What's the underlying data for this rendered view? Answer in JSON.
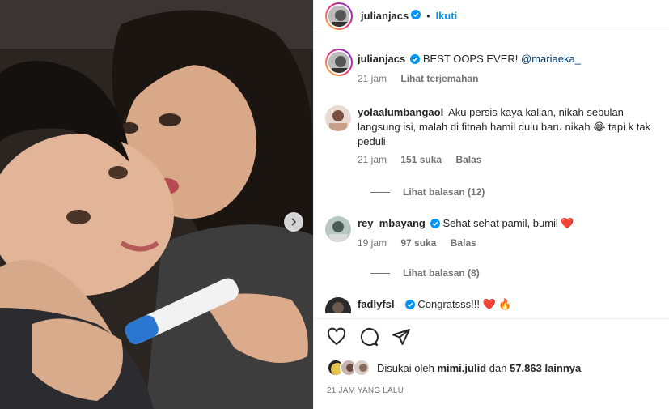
{
  "header": {
    "username": "julianjacs",
    "dot": "•",
    "follow_label": "Ikuti"
  },
  "caption": {
    "username": "julianjacs",
    "text": "BEST OOPS EVER! ",
    "mention": "@mariaeka_",
    "time": "21 jam",
    "translate_label": "Lihat terjemahan"
  },
  "comments": [
    {
      "username": "yolaalumbangaol",
      "text": "Aku persis kaya kalian, nikah sebulan langsung isi, malah di fitnah hamil dulu baru nikah 😂 tapi k tak peduli",
      "time": "21 jam",
      "likes": "151 suka",
      "reply_label": "Balas",
      "view_replies": "Lihat balasan (12)"
    },
    {
      "username": "rey_mbayang",
      "text": "Sehat sehat pamil, bumil ❤️",
      "time": "19 jam",
      "likes": "97 suka",
      "reply_label": "Balas",
      "view_replies": "Lihat balasan (8)"
    },
    {
      "username": "fadlyfsl_",
      "text": "Congratsss!!! ❤️ 🔥"
    }
  ],
  "likes_line": {
    "prefix": "Disukai oleh ",
    "user": "mimi.julid",
    "middle": " dan ",
    "count": "57.863 lainnya"
  },
  "time_ago": "21 JAM YANG LALU",
  "colors": {
    "accent": "#0095f6",
    "verified": "#0095f6",
    "muted": "#737373",
    "text": "#262626"
  },
  "icons": [
    "chevron-right-icon",
    "verified-icon",
    "heart-icon",
    "comment-icon",
    "share-icon"
  ]
}
